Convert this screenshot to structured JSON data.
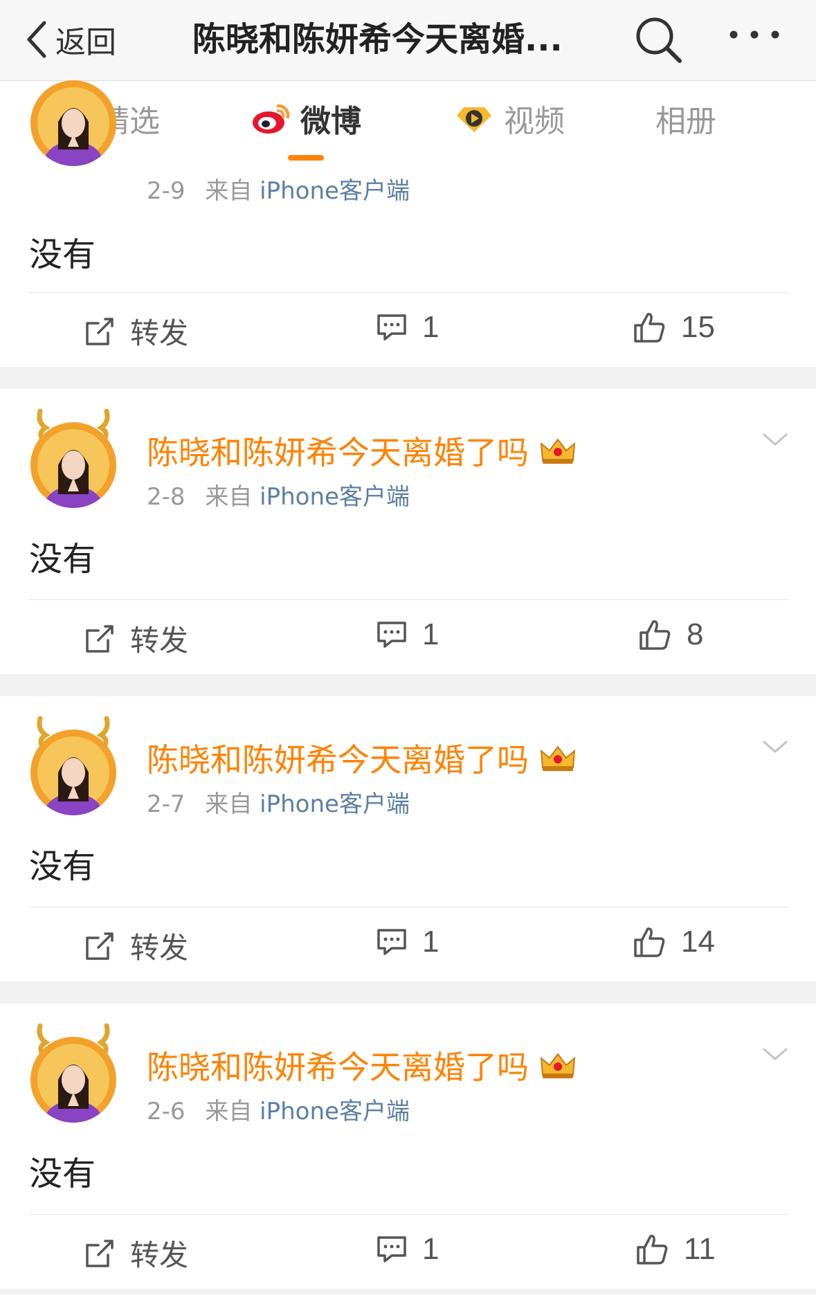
{
  "nav": {
    "back_label": "返回",
    "title": "陈晓和陈妍希今天离婚...",
    "search_icon": "search-icon",
    "more_icon": "more-icon"
  },
  "tabs": [
    {
      "label": "精选",
      "active": false
    },
    {
      "label": "微博",
      "active": true,
      "icon": "weibo-logo-icon"
    },
    {
      "label": "视频",
      "active": false,
      "icon": "video-badge-icon"
    },
    {
      "label": "相册",
      "active": false
    }
  ],
  "colors": {
    "accent": "#ff8200",
    "source_link": "#5b7ea6",
    "meta": "#999999",
    "background": "#f2f2f2"
  },
  "posts": [
    {
      "username": "",
      "date": "2-9",
      "from_label": "来自",
      "source": "iPhone客户端",
      "text": "没有",
      "repost_label": "转发",
      "comments": "1",
      "likes": "15"
    },
    {
      "username": "陈晓和陈妍希今天离婚了吗",
      "date": "2-8",
      "from_label": "来自",
      "source": "iPhone客户端",
      "text": "没有",
      "repost_label": "转发",
      "comments": "1",
      "likes": "8"
    },
    {
      "username": "陈晓和陈妍希今天离婚了吗",
      "date": "2-7",
      "from_label": "来自",
      "source": "iPhone客户端",
      "text": "没有",
      "repost_label": "转发",
      "comments": "1",
      "likes": "14"
    },
    {
      "username": "陈晓和陈妍希今天离婚了吗",
      "date": "2-6",
      "from_label": "来自",
      "source": "iPhone客户端",
      "text": "没有",
      "repost_label": "转发",
      "comments": "1",
      "likes": "11"
    }
  ]
}
